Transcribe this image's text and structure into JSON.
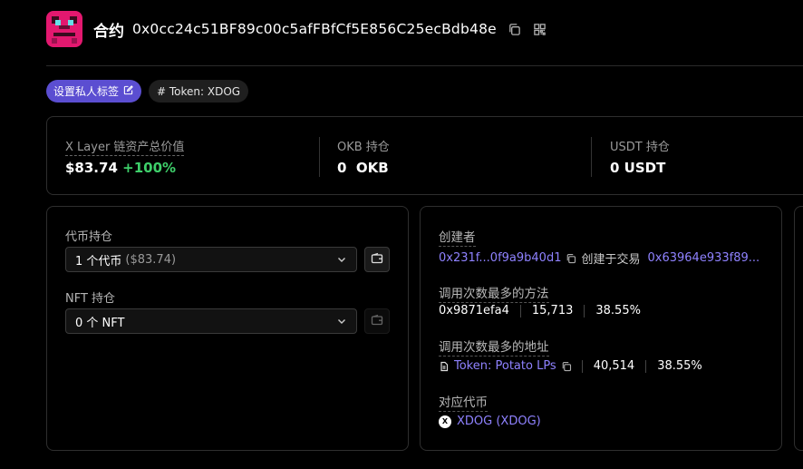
{
  "header": {
    "label": "合约",
    "address": "0x0cc24c51BF89c00c5afFBfCf5E856C25ecBdb48e",
    "icons": [
      "copy-icon",
      "qr-code-icon"
    ],
    "avatar_color": "#e3186f"
  },
  "tags": {
    "private_label": "设置私人标签",
    "token_tag": "# Token: XDOG"
  },
  "summary": {
    "total_label": "X Layer 链资产总价值",
    "total_value": "$83.74",
    "total_change": "+100%",
    "okb_label": "OKB 持仓",
    "okb_value": "0  OKB",
    "usdt_label": "USDT 持仓",
    "usdt_value": "0 USDT"
  },
  "holdings": {
    "token_label": "代币持仓",
    "token_select_value": "1 个代币",
    "token_select_amount": "($83.74)",
    "nft_label": "NFT 持仓",
    "nft_select_value": "0 个 NFT"
  },
  "info": {
    "creator_label": "创建者",
    "creator_address": "0x231f...0f9a9b40d1",
    "created_in_tx_text": "创建于交易",
    "tx_hash": "0x63964e933f89...",
    "top_method_label": "调用次数最多的方法",
    "top_method": {
      "id": "0x9871efa4",
      "count": "15,713",
      "pct": "38.55%"
    },
    "top_address_label": "调用次数最多的地址",
    "top_address": {
      "name": "Token: Potato LPs",
      "count": "40,514",
      "pct": "38.55%"
    },
    "token_label": "对应代币",
    "token_symbol_badge": "X",
    "token_name": "XDOG (XDOG)"
  },
  "colors": {
    "accent": "#5b4ed1",
    "link": "#8f82ff",
    "positive": "#3ecf6a"
  }
}
